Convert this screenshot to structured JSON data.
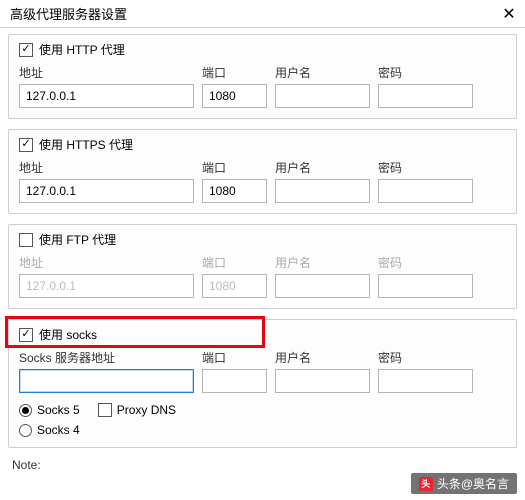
{
  "window": {
    "title": "高级代理服务器设置"
  },
  "labels": {
    "address": "地址",
    "port": "端口",
    "username": "用户名",
    "password": "密码",
    "socks_address": "Socks 服务器地址"
  },
  "http": {
    "use_label": "使用 HTTP 代理",
    "checked": true,
    "address": "127.0.0.1",
    "port": "1080",
    "username": "",
    "password": ""
  },
  "https": {
    "use_label": "使用 HTTPS 代理",
    "checked": true,
    "address": "127.0.0.1",
    "port": "1080",
    "username": "",
    "password": ""
  },
  "ftp": {
    "use_label": "使用 FTP 代理",
    "checked": false,
    "address": "127.0.0.1",
    "port": "1080",
    "username": "",
    "password": ""
  },
  "socks": {
    "use_label": "使用 socks",
    "checked": true,
    "address": "",
    "port": "",
    "username": "",
    "password": "",
    "radio_socks5": "Socks 5",
    "radio_socks4": "Socks 4",
    "proxy_dns_label": "Proxy DNS",
    "proxy_dns_checked": false,
    "selected": "socks5"
  },
  "note": "Note:",
  "watermark": "头条@奥名言"
}
